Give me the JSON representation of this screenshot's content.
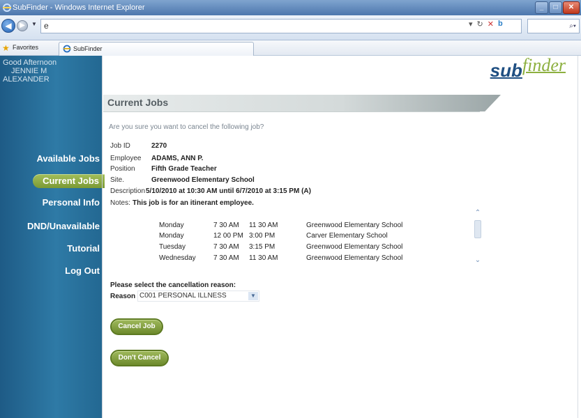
{
  "window": {
    "title": "SubFinder - Windows Internet Explorer"
  },
  "browser": {
    "address": "e",
    "favorites_label": "Favorites",
    "tab_title": "SubFinder"
  },
  "sidebar": {
    "greeting_lines": [
      "Good Afternoon",
      "JENNIE M",
      "ALEXANDER"
    ],
    "menu": [
      {
        "label": "Available Jobs",
        "active": false
      },
      {
        "label": "Current Jobs",
        "active": true
      },
      {
        "label": "Personal Info",
        "active": false
      },
      {
        "label": "DND/Unavailable",
        "active": false
      },
      {
        "label": "Tutorial",
        "active": false
      },
      {
        "label": "Log Out",
        "active": false
      }
    ]
  },
  "logo": {
    "part1": "sub",
    "part2": "finder"
  },
  "section": {
    "title": "Current Jobs"
  },
  "confirm_question": "Are you sure you want to cancel the following job?",
  "job": {
    "id_label": "Job ID",
    "id": "2270",
    "employee_label": "Employee",
    "employee": "ADAMS, ANN P.",
    "position_label": "Position",
    "position": "Fifth Grade Teacher",
    "site_label": "Site.",
    "site": "Greenwood Elementary School",
    "description_label": "Description",
    "description": "5/10/2010 at 10:30 AM until 6/7/2010 at 3:15 PM (A)",
    "notes_label": "Notes:",
    "notes": "This job is for an itinerant employee."
  },
  "schedule": [
    {
      "day": "Monday",
      "start": "7 30 AM",
      "end": "11 30 AM",
      "site": "Greenwood Elementary School"
    },
    {
      "day": "Monday",
      "start": "12 00 PM",
      "end": "3:00 PM",
      "site": "Carver Elementary School"
    },
    {
      "day": "Tuesday",
      "start": "7 30 AM",
      "end": "3:15 PM",
      "site": "Greenwood Elementary School"
    },
    {
      "day": "Wednesday",
      "start": "7 30 AM",
      "end": "11 30 AM",
      "site": "Greenwood Elementary School"
    }
  ],
  "cancellation": {
    "prompt": "Please select the cancellation reason:",
    "reason_label": "Reason",
    "selected": "C001 PERSONAL ILLNESS"
  },
  "buttons": {
    "cancel_job": "Cancel Job",
    "dont_cancel": "Don't Cancel"
  },
  "colors": {
    "sidebar": "#2a6f9c",
    "accent_green": "#8aa845",
    "logo_blue": "#1f4f82"
  }
}
